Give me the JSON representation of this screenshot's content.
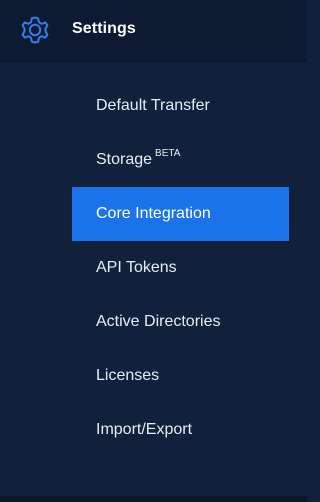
{
  "header": {
    "title": "Settings",
    "icon": "gear-icon"
  },
  "menu": {
    "items": [
      {
        "label": "Default Transfer",
        "badge": ""
      },
      {
        "label": "Storage",
        "badge": "BETA"
      },
      {
        "label": "Core Integration",
        "badge": ""
      },
      {
        "label": "API Tokens",
        "badge": ""
      },
      {
        "label": "Active Directories",
        "badge": ""
      },
      {
        "label": "Licenses",
        "badge": ""
      },
      {
        "label": "Import/Export",
        "badge": ""
      }
    ],
    "active_label": "Core Integration"
  },
  "colors": {
    "background": "#11203b",
    "active": "#1a73e8",
    "icon": "#2f80ed"
  }
}
